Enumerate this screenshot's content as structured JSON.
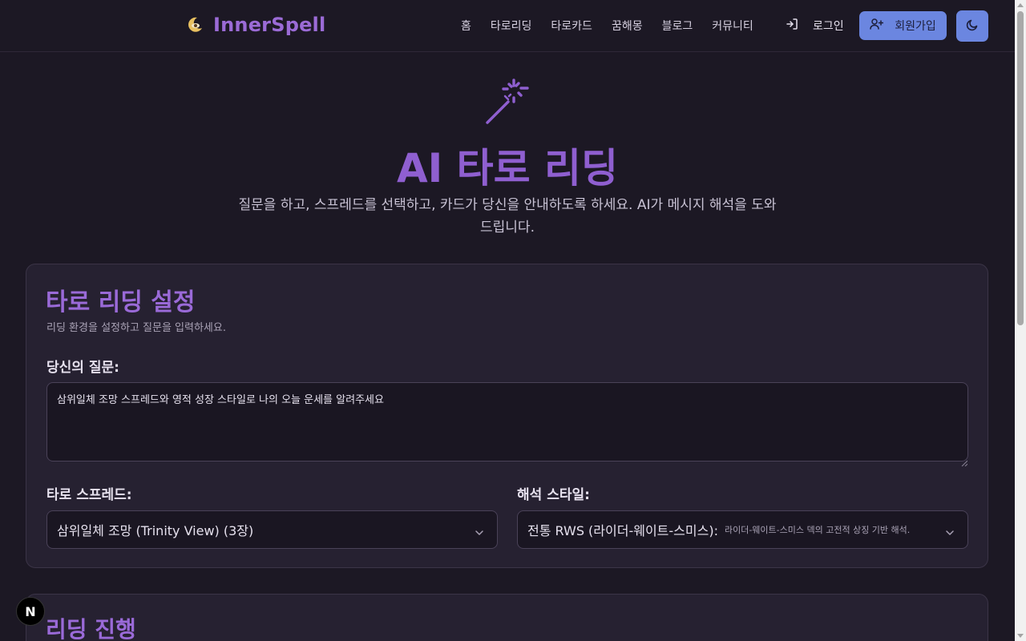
{
  "header": {
    "brand": "InnerSpell",
    "nav": [
      "홈",
      "타로리딩",
      "타로카드",
      "꿈해몽",
      "블로그",
      "커뮤니티"
    ],
    "login_label": "로그인",
    "signup_label": "회원가입"
  },
  "hero": {
    "title": "AI 타로 리딩",
    "subtitle": "질문을 하고, 스프레드를 선택하고, 카드가 당신을 안내하도록 하세요. AI가 메시지 해석을 도와드립니다."
  },
  "settings": {
    "title": "타로 리딩 설정",
    "description": "리딩 환경을 설정하고 질문을 입력하세요.",
    "question_label": "당신의 질문:",
    "question_value": "삼위일체 조망 스프레드와 영적 성장 스타일로 나의 오늘 운세를 알려주세요",
    "spread_label": "타로 스프레드:",
    "spread_value": "삼위일체 조망 (Trinity View) (3장)",
    "style_label": "해석 스타일:",
    "style_value": "전통 RWS (라이더-웨이트-스미스):",
    "style_desc": "라이더-웨이트-스미스 덱의 고전적 상징 기반 해석."
  },
  "progress": {
    "title": "리딩 진행"
  },
  "badge": "N",
  "colors": {
    "accent": "#9a6ad8",
    "button": "#6b86e0",
    "background": "#1c1824",
    "card": "#262131"
  }
}
